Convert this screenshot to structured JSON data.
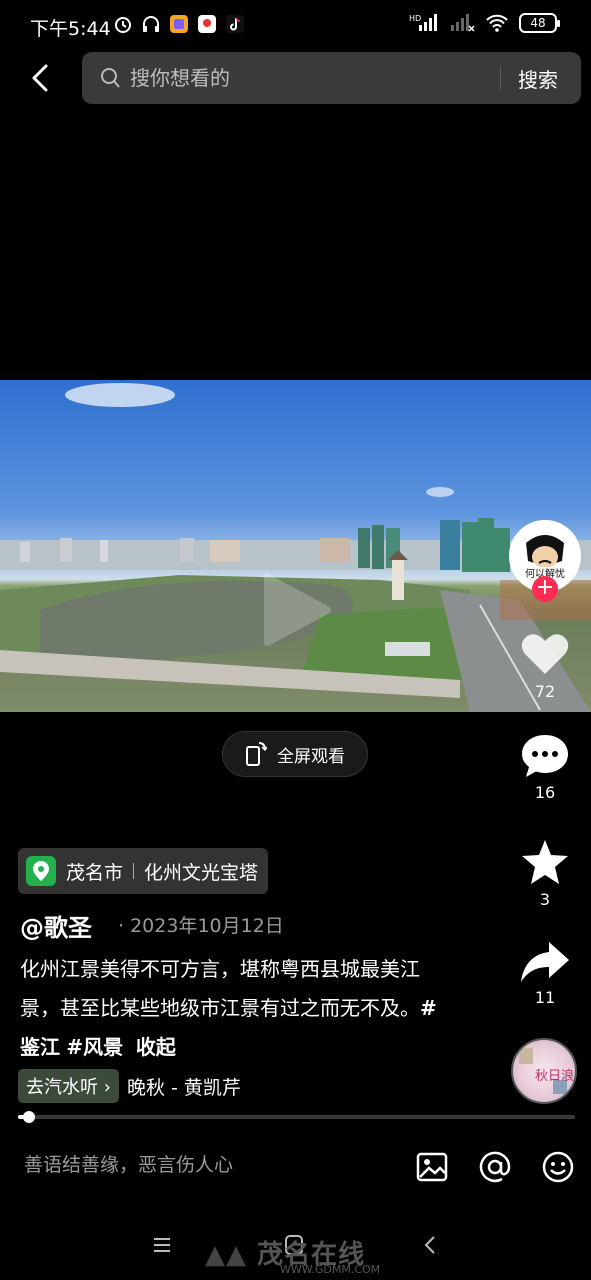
{
  "status_bar": {
    "time": "下午5:44",
    "battery": "48",
    "hd_label": "HD"
  },
  "search": {
    "placeholder": "搜你想看的",
    "button_label": "搜索"
  },
  "video": {
    "fullscreen_label": "全屏观看"
  },
  "author_avatar_text": "何以解忧",
  "actions": {
    "likes": "72",
    "comments": "16",
    "favorites": "3",
    "shares": "11"
  },
  "location": {
    "city": "茂名市",
    "place": "化州文光宝塔"
  },
  "post": {
    "author": "@歌圣",
    "date": "2023年10月12日",
    "description": "化州江景美得不可方言，堪称粤西县城最美江景，甚至比某些地级市江景有过之而无不及。",
    "tags": [
      "#鉴江",
      "#风景"
    ],
    "collapse_label": "收起"
  },
  "music": {
    "button_label": "去汽水听",
    "track": "晚秋 - 黄凯芹",
    "disc_text": "秋日浪漫"
  },
  "progress": 0.013,
  "comment": {
    "placeholder": "善语结善缘，恶言伤人心"
  },
  "watermark": {
    "title": "茂名在线",
    "url": "WWW.GDMM.COM"
  },
  "colors": {
    "background": "#000000",
    "accent": "#fe2c55",
    "location_green": "#22b14c"
  }
}
